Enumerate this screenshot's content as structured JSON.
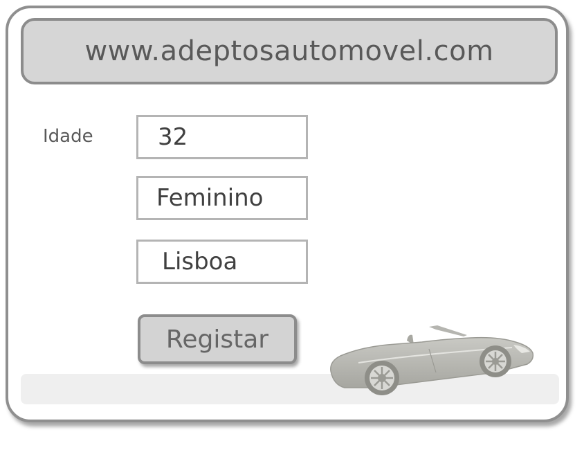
{
  "header": {
    "url": "www.adeptosautomovel.com"
  },
  "form": {
    "age_label": "Idade",
    "age_value": "32",
    "gender_value": "Feminino",
    "city_value": "Lisboa",
    "register_label": "Registar"
  },
  "decoration": {
    "car_icon": "convertible-car-icon"
  },
  "colors": {
    "frame_border": "#8f8f8f",
    "url_bar_fill": "#d6d6d6",
    "button_fill": "#d3d3d3",
    "field_border": "#b4b4b4",
    "text_dark": "#404040"
  }
}
